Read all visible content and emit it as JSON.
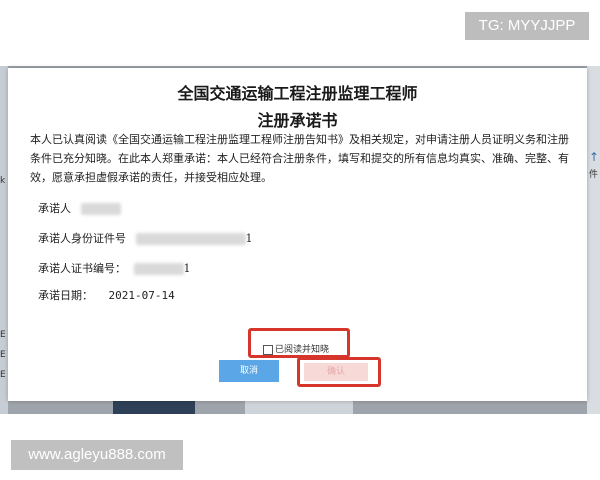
{
  "watermark": {
    "top_tag": "TG: MYYJJPP",
    "bottom_url": "www.agleyu888.com"
  },
  "background": {
    "right_label": "件",
    "left_labels": [
      "k",
      "k",
      "E",
      "E",
      "E"
    ]
  },
  "modal": {
    "title_line1": "全国交通运输工程注册监理工程师",
    "title_line2": "注册承诺书",
    "body": "本人已认真阅读《全国交通运输工程注册监理工程师注册告知书》及相关规定，对申请注册人员证明义务和注册条件已充分知晓。在此本人郑重承诺：本人已经符合注册条件，填写和提交的所有信息均真实、准确、完整、有效，愿意承担虚假承诺的责任，并接受相应处理。",
    "fields": {
      "promiser_label": "承诺人",
      "id_label": "承诺人身份证件号",
      "id_suffix": "1",
      "cert_label": "承诺人证书编号：",
      "cert_suffix": "1",
      "date_label": "承诺日期：",
      "date_value": "2021-07-14"
    },
    "agree_label": "已阅读并知晓",
    "cancel_label": "取消",
    "confirm_label": "确认"
  },
  "colors": {
    "highlight_red": "#d6352c",
    "cancel_blue": "#5aa6e6",
    "confirm_disabled": "#f7d9d8"
  }
}
